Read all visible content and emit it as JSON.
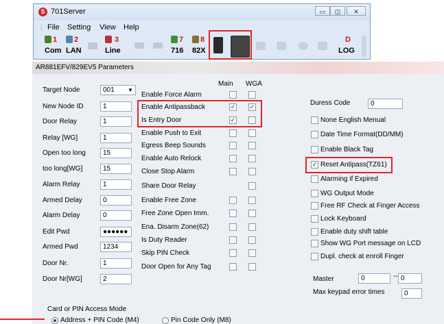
{
  "window": {
    "title": "701Server",
    "app_icon": "S",
    "min": "▭",
    "restore": "◫",
    "close": "✕"
  },
  "menu": [
    "File",
    "Setting",
    "View",
    "Help"
  ],
  "toolbar": {
    "com": {
      "top": "1",
      "label": "Com"
    },
    "lan": {
      "top": "2",
      "label": "LAN"
    },
    "line": {
      "top": "3",
      "label": "Line"
    },
    "t716": {
      "top": "7",
      "label": "716"
    },
    "t82x": {
      "top": "8",
      "label": "82X"
    },
    "log": {
      "top": "D",
      "label": "LOG"
    }
  },
  "params": {
    "title": "AR881EFV/829EV5 Parameters",
    "col_main": "Main",
    "col_wga": "WGA",
    "left": [
      {
        "label": "Target Node",
        "value": "001",
        "type": "select"
      },
      {
        "label": "New Node ID",
        "value": "1"
      },
      {
        "label": "Door Relay",
        "value": "1"
      },
      {
        "label": "Relay [WG]",
        "value": "1"
      },
      {
        "label": "Open too long",
        "value": "15"
      },
      {
        "label": "too long[WG]",
        "value": "15"
      },
      {
        "label": "Alarm Relay",
        "value": "1"
      },
      {
        "label": "Armed Delay",
        "value": "0"
      },
      {
        "label": "Alarm Delay",
        "value": "0"
      },
      {
        "label": "Edit Pwd",
        "value": "●●●●●●"
      },
      {
        "label": "Armed Pwd",
        "value": "1234"
      },
      {
        "label": "Door Nr.",
        "value": "1"
      },
      {
        "label": "Door Nr[WG]",
        "value": "2"
      }
    ],
    "middle": [
      {
        "label": "Enable Force Alarm",
        "main": false,
        "wga": false
      },
      {
        "label": "Enable Antipassback",
        "main": true,
        "wga": true
      },
      {
        "label": "Is Entry Door",
        "main": true,
        "wga": false
      },
      {
        "label": "Enable Push to Exit",
        "main": false,
        "wga": false
      },
      {
        "label": "Egress Beep Sounds",
        "main": false,
        "wga": false
      },
      {
        "label": "Enable Auto Relock",
        "main": false,
        "wga": false
      },
      {
        "label": "Close Stop Alarm",
        "main": false,
        "wga": false
      },
      {
        "label": "Share Door Relay",
        "wga": false
      },
      {
        "label": "Enable Free Zone",
        "main": false,
        "wga": false
      },
      {
        "label": "Free Zone Open Imm.",
        "main": false,
        "wga": false
      },
      {
        "label": "Ena. Disarm Zone(62)",
        "main": false,
        "wga": false
      },
      {
        "label": "Is Duty Reader",
        "main": false,
        "wga": false
      },
      {
        "label": "Skip PIN Check",
        "main": false,
        "wga": false
      },
      {
        "label": "Door Open for Any Tag",
        "main": false,
        "wga": false
      }
    ],
    "duress_label": "Duress Code",
    "duress_value": "0",
    "right": [
      {
        "label": "None English Menual",
        "checked": false
      },
      {
        "label": "Date Time Format(DD/MM)",
        "checked": false
      },
      {
        "label": "Enable Black Tag",
        "checked": false
      },
      {
        "label": "Reset Antipass(TZ61)",
        "checked": true
      },
      {
        "label": "Alarming if Expired",
        "checked": false
      },
      {
        "label": "WG Output Mode",
        "checked": false
      },
      {
        "label": "Free RF Check at Finger Access",
        "checked": false
      },
      {
        "label": "Lock Keyboard",
        "checked": false
      },
      {
        "label": "Enable duty shift table",
        "checked": false
      },
      {
        "label": "Show WG Port message on LCD",
        "checked": false
      },
      {
        "label": "Dupl. check at enroll  Finger",
        "checked": false
      }
    ],
    "master_label": "Master",
    "master_from": "0",
    "master_sep": "---",
    "master_to": "0",
    "max_keypad_label": "Max keypad error times",
    "max_keypad_value": "0",
    "access_mode": {
      "title": "Card or PIN Access Mode",
      "opt1": "Address + PIN Code (M4)",
      "opt2": "Pin Code Only (M8)"
    }
  }
}
